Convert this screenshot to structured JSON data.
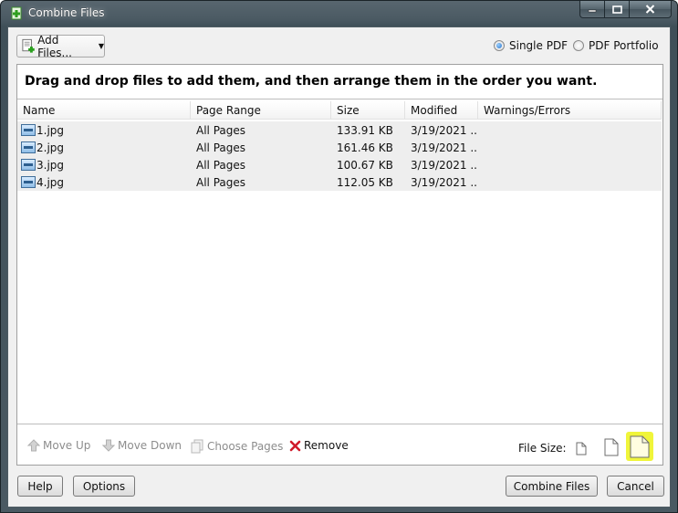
{
  "window": {
    "title": "Combine Files",
    "controls": [
      "minimize-icon",
      "maximize-icon",
      "close-icon"
    ]
  },
  "toolbar": {
    "add_files_label": "Add Files...",
    "output_options": [
      {
        "label": "Single PDF",
        "checked": true
      },
      {
        "label": "PDF Portfolio",
        "checked": false
      }
    ]
  },
  "panel": {
    "instruction": "Drag and drop files to add them, and then arrange them in the order you want."
  },
  "table": {
    "columns": [
      "Name",
      "Page Range",
      "Size",
      "Modified",
      "Warnings/Errors"
    ],
    "rows": [
      {
        "name": "1.jpg",
        "page_range": "All Pages",
        "size": "133.91 KB",
        "modified": "3/19/2021 ...",
        "warnings": ""
      },
      {
        "name": "2.jpg",
        "page_range": "All Pages",
        "size": "161.46 KB",
        "modified": "3/19/2021 ...",
        "warnings": ""
      },
      {
        "name": "3.jpg",
        "page_range": "All Pages",
        "size": "100.67 KB",
        "modified": "3/19/2021 ...",
        "warnings": ""
      },
      {
        "name": "4.jpg",
        "page_range": "All Pages",
        "size": "112.05 KB",
        "modified": "3/19/2021 ...",
        "warnings": ""
      }
    ]
  },
  "bottom_toolbar": {
    "move_up": "Move Up",
    "move_down": "Move Down",
    "choose_pages": "Choose Pages",
    "remove": "Remove",
    "file_size_label": "File Size:",
    "file_size_options": [
      "small-file-size-icon",
      "default-file-size-icon",
      "large-file-size-icon"
    ],
    "file_size_selected": "large-file-size-icon"
  },
  "footer": {
    "help": "Help",
    "options": "Options",
    "combine": "Combine Files",
    "cancel": "Cancel"
  },
  "colors": {
    "highlight": "#f0f53a",
    "row_bg": "#eeeeee",
    "remove_x": "#d01a2a",
    "disabled_text": "#8d8d8d"
  }
}
